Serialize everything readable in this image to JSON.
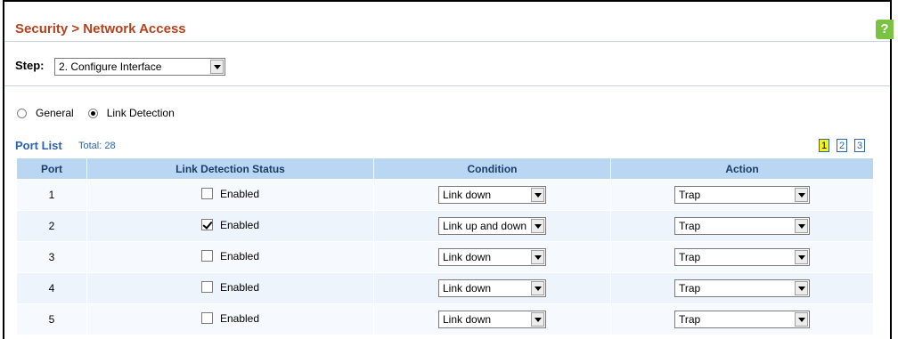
{
  "header": {
    "title": "Security > Network Access",
    "help_label": "?"
  },
  "step": {
    "label": "Step:",
    "value": "2. Configure Interface"
  },
  "mode": {
    "options": [
      {
        "label": "General",
        "selected": false
      },
      {
        "label": "Link Detection",
        "selected": true
      }
    ]
  },
  "port_list": {
    "title": "Port List",
    "total": "Total: 28",
    "pages": [
      "1",
      "2",
      "3"
    ],
    "current_page": "1"
  },
  "table": {
    "columns": [
      "Port",
      "Link Detection Status",
      "Condition",
      "Action"
    ],
    "rows": [
      {
        "port": "1",
        "enabled_label": "Enabled",
        "enabled": false,
        "condition": "Link down",
        "action": "Trap"
      },
      {
        "port": "2",
        "enabled_label": "Enabled",
        "enabled": true,
        "condition": "Link up and down",
        "action": "Trap"
      },
      {
        "port": "3",
        "enabled_label": "Enabled",
        "enabled": false,
        "condition": "Link down",
        "action": "Trap"
      },
      {
        "port": "4",
        "enabled_label": "Enabled",
        "enabled": false,
        "condition": "Link down",
        "action": "Trap"
      },
      {
        "port": "5",
        "enabled_label": "Enabled",
        "enabled": false,
        "condition": "Link down",
        "action": "Trap"
      }
    ]
  },
  "colors": {
    "title": "#b3421d",
    "header_bg": "#b9d7f2",
    "link": "#2b63b0",
    "help_bg": "#7cc242",
    "current_page_bg": "#f5f21a"
  }
}
